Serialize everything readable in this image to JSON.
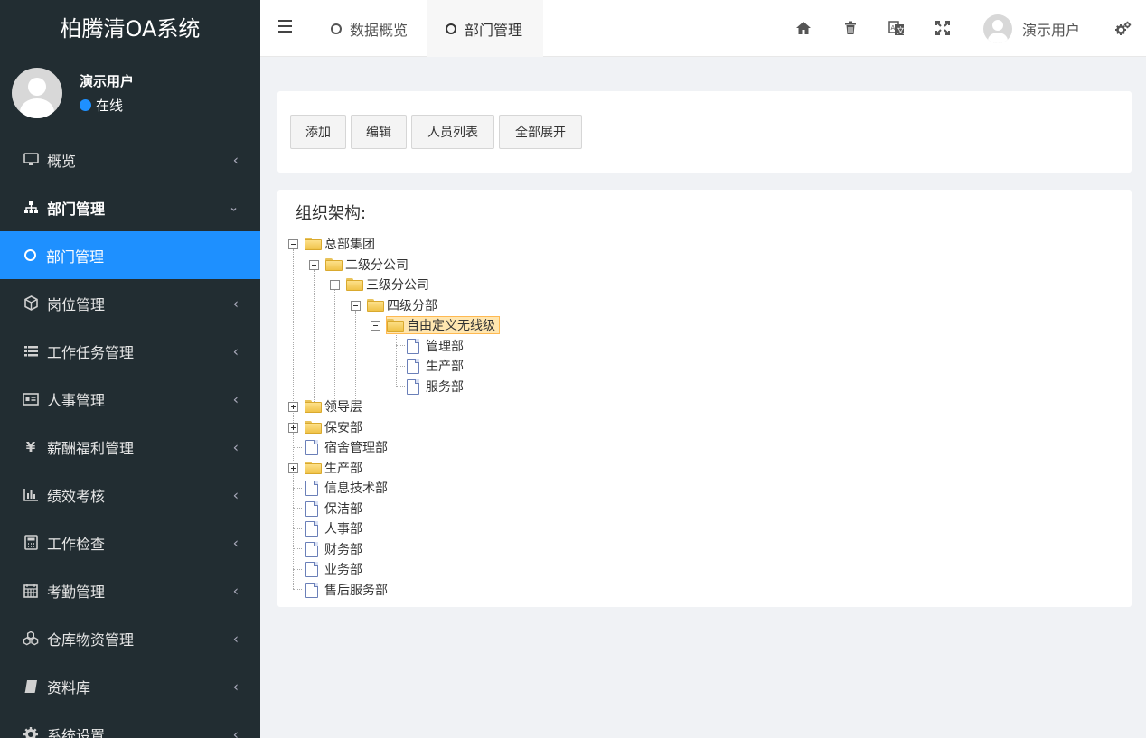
{
  "app": {
    "title": "柏腾清OA系统"
  },
  "user": {
    "name": "演示用户",
    "status": "在线"
  },
  "sidebar": {
    "items": [
      {
        "label": "概览",
        "icon": "monitor-icon"
      },
      {
        "label": "部门管理",
        "icon": "sitemap-icon",
        "open": true
      },
      {
        "label": "部门管理",
        "icon": "circle-icon",
        "active": true
      },
      {
        "label": "岗位管理",
        "icon": "cube-icon"
      },
      {
        "label": "工作任务管理",
        "icon": "list-icon"
      },
      {
        "label": "人事管理",
        "icon": "id-card-icon"
      },
      {
        "label": "薪酬福利管理",
        "icon": "yen-icon"
      },
      {
        "label": "绩效考核",
        "icon": "bar-chart-icon"
      },
      {
        "label": "工作检查",
        "icon": "calculator-icon"
      },
      {
        "label": "考勤管理",
        "icon": "calendar-icon"
      },
      {
        "label": "仓库物资管理",
        "icon": "cubes-icon"
      },
      {
        "label": "资料库",
        "icon": "book-icon"
      },
      {
        "label": "系统设置",
        "icon": "gear-icon"
      }
    ]
  },
  "topbar": {
    "tabs": [
      {
        "label": "数据概览"
      },
      {
        "label": "部门管理",
        "active": true
      }
    ],
    "user_name": "演示用户",
    "icons": [
      "home-icon",
      "trash-icon",
      "translate-icon",
      "fullscreen-icon",
      "settings-icon"
    ]
  },
  "toolbar": {
    "add_label": "添加",
    "edit_label": "编辑",
    "staff_label": "人员列表",
    "expand_label": "全部展开"
  },
  "tree": {
    "title": "组织架构:",
    "nodes": [
      {
        "label": "总部集团",
        "type": "folder",
        "expanded": true
      },
      {
        "label": "二级分公司",
        "type": "folder",
        "expanded": true
      },
      {
        "label": "三级分公司",
        "type": "folder",
        "expanded": true
      },
      {
        "label": "四级分部",
        "type": "folder",
        "expanded": true
      },
      {
        "label": "自由定义无线级",
        "type": "folder",
        "expanded": true,
        "selected": true
      },
      {
        "label": "管理部",
        "type": "doc"
      },
      {
        "label": "生产部",
        "type": "doc"
      },
      {
        "label": "服务部",
        "type": "doc"
      },
      {
        "label": "领导层",
        "type": "folder",
        "expanded": false
      },
      {
        "label": "保安部",
        "type": "folder",
        "expanded": false
      },
      {
        "label": "宿舍管理部",
        "type": "doc"
      },
      {
        "label": "生产部",
        "type": "folder",
        "expanded": false
      },
      {
        "label": "信息技术部",
        "type": "doc"
      },
      {
        "label": "保洁部",
        "type": "doc"
      },
      {
        "label": "人事部",
        "type": "doc"
      },
      {
        "label": "财务部",
        "type": "doc"
      },
      {
        "label": "业务部",
        "type": "doc"
      },
      {
        "label": "售后服务部",
        "type": "doc"
      }
    ]
  }
}
